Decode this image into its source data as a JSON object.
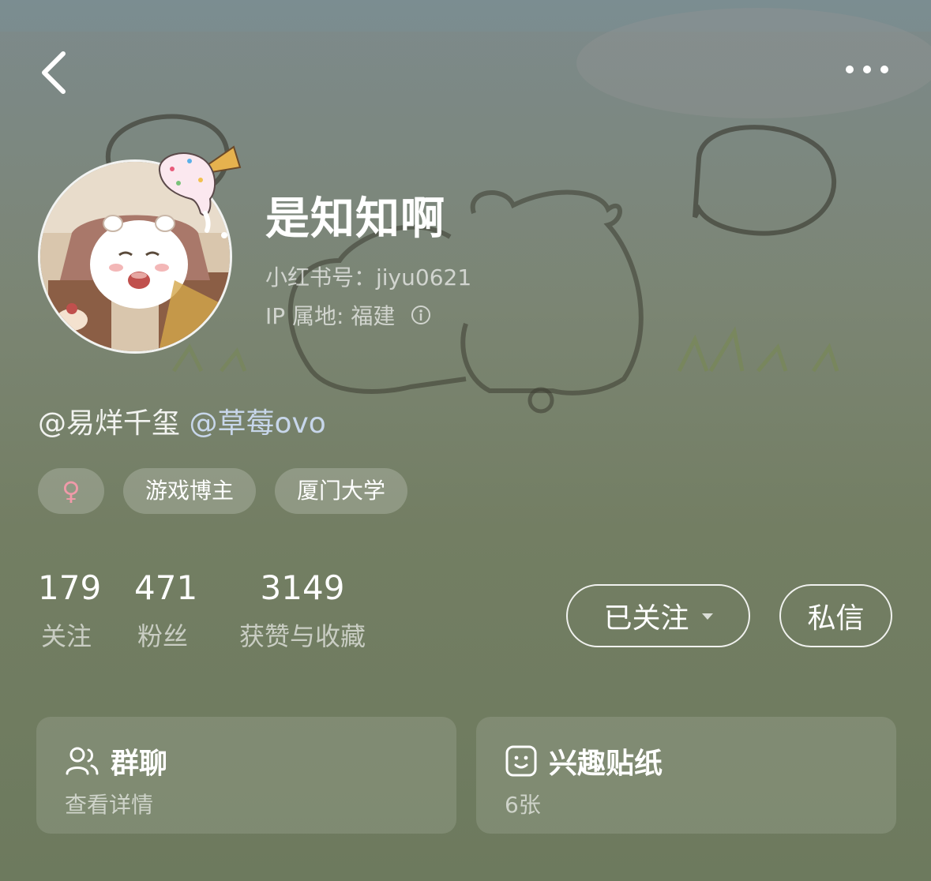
{
  "nav": {
    "back_icon": "chevron-left-icon",
    "more_icon": "more-dots-icon"
  },
  "profile": {
    "nickname": "是知知啊",
    "account_id": "小红书号：jiyu0621",
    "ip_location": "IP 属地: 福建"
  },
  "bio": {
    "mention_1": "@易烊千玺",
    "mention_2": "@草莓ovo"
  },
  "tags": {
    "gender_symbol": "♀",
    "items": [
      "游戏博主",
      "厦门大学"
    ]
  },
  "stats": [
    {
      "value": "179",
      "label": "关注"
    },
    {
      "value": "471",
      "label": "粉丝"
    },
    {
      "value": "3149",
      "label": "获赞与收藏"
    }
  ],
  "actions": {
    "follow_label": "已关注",
    "message_label": "私信"
  },
  "cards": [
    {
      "title": "群聊",
      "subtitle": "查看详情",
      "icon": "group-users-icon"
    },
    {
      "title": "兴趣贴纸",
      "subtitle": "6张",
      "icon": "sticker-face-icon"
    }
  ],
  "colors": {
    "gender": "#f09aa9",
    "mention_highlight": "#c7d6ea"
  }
}
